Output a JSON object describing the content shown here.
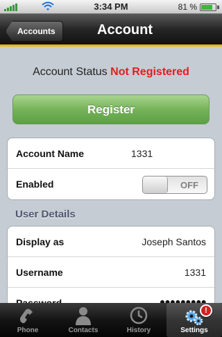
{
  "status_bar": {
    "time": "3:34 PM",
    "battery_percent": "81 %",
    "battery_level": 0.81,
    "signal_icon": "signal-bars-icon",
    "wifi_icon": "wifi-icon"
  },
  "navbar": {
    "back_label": "Accounts",
    "title": "Account"
  },
  "account_status": {
    "label": "Account Status",
    "value": "Not Registered",
    "value_color": "#e41c1c"
  },
  "register_button": {
    "label": "Register"
  },
  "account_group": {
    "account_name_label": "Account Name",
    "account_name_value": "1331",
    "enabled_label": "Enabled",
    "enabled_toggle_text": "OFF"
  },
  "user_details": {
    "header": "User Details",
    "display_as_label": "Display as",
    "display_as_value": "Joseph Santos",
    "username_label": "Username",
    "username_value": "1331",
    "password_label": "Password",
    "password_value": "●●●●●●●●●"
  },
  "tabbar": {
    "tabs": [
      {
        "label": "Phone",
        "icon": "phone-icon"
      },
      {
        "label": "Contacts",
        "icon": "contacts-icon"
      },
      {
        "label": "History",
        "icon": "clock-icon"
      },
      {
        "label": "Settings",
        "icon": "gears-icon",
        "badge": "!"
      }
    ],
    "selected_index": 3
  },
  "colors": {
    "accent_yellow": "#f2b400",
    "register_green": "#76b35a",
    "section_header": "#4c566c"
  }
}
